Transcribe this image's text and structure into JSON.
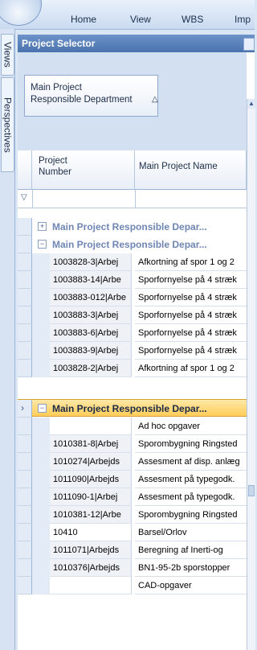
{
  "menu": {
    "home": "Home",
    "view": "View",
    "wbs": "WBS",
    "import": "Imp"
  },
  "side_tabs": {
    "views": "Views",
    "perspectives": "Perspectives"
  },
  "panel": {
    "title": "Project Selector",
    "group_by_line1": "Main Project",
    "group_by_line2": "Responsible Department",
    "columns": {
      "number_line1": "Project",
      "number_line2": "Number",
      "name": "Main Project Name"
    }
  },
  "groups": {
    "g1": "Main Project Responsible Depar...",
    "g2": "Main Project Responsible Depar...",
    "g3": "Main Project Responsible Depar..."
  },
  "rows_g2": [
    {
      "number": "1003828-3|Arbej",
      "name": "Afkortning af spor 1 og 2"
    },
    {
      "number": "1003883-14|Arbe",
      "name": "Sporfornyelse på 4 stræk"
    },
    {
      "number": "1003883-012|Arbe",
      "name": "Sporfornyelse på 4 stræk"
    },
    {
      "number": "1003883-3|Arbej",
      "name": "Sporfornyelse på 4 stræk"
    },
    {
      "number": "1003883-6|Arbej",
      "name": "Sporfornyelse på 4 stræk"
    },
    {
      "number": "1003883-9|Arbej",
      "name": "Sporfornyelse på 4 stræk"
    },
    {
      "number": "1003828-2|Arbej",
      "name": "Afkortning af spor 1 og 2"
    }
  ],
  "rows_g3": [
    {
      "number": "",
      "name": "Ad hoc opgaver"
    },
    {
      "number": "1010381-8|Arbej",
      "name": "Sporombygning Ringsted"
    },
    {
      "number": "1010274|Arbejds",
      "name": "Assesment af disp. anlæg"
    },
    {
      "number": "1011090|Arbejds",
      "name": "Assesment på typegodk."
    },
    {
      "number": "1011090-1|Arbej",
      "name": "Assesment på typegodk."
    },
    {
      "number": "1010381-12|Arbe",
      "name": "Sporombygning Ringsted"
    },
    {
      "number": "10410",
      "name": "Barsel/Orlov"
    },
    {
      "number": "1011071|Arbejds",
      "name": "Beregning af Inerti-og"
    },
    {
      "number": "1010376|Arbejds",
      "name": "BN1-95-2b sporstopper"
    },
    {
      "number": "",
      "name": "CAD-opgaver"
    }
  ]
}
